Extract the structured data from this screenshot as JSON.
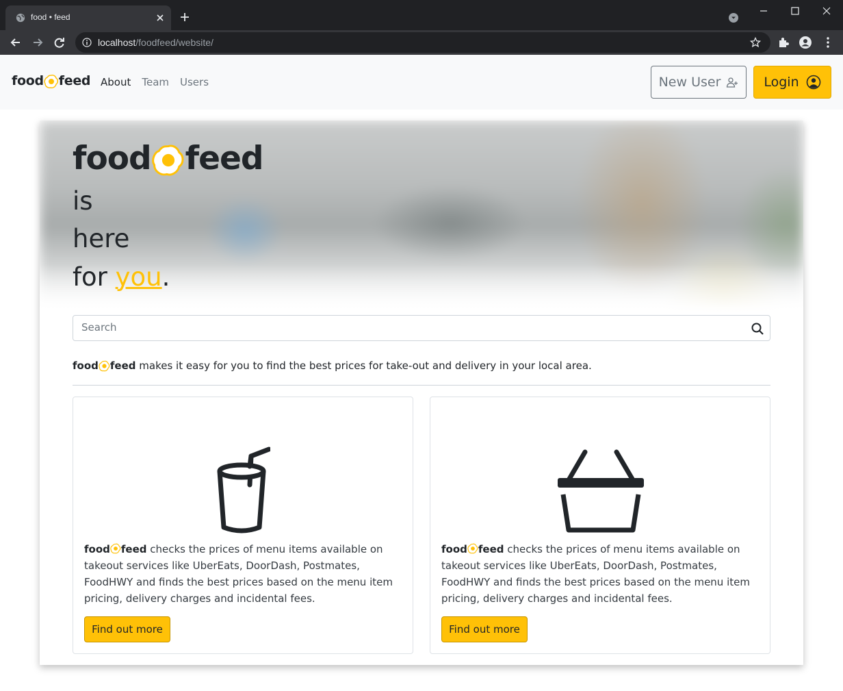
{
  "browser": {
    "tab_title": "food • feed",
    "url_host": "localhost",
    "url_path": "/foodfeed/website/"
  },
  "navbar": {
    "brand_left": "food",
    "brand_right": "feed",
    "links": [
      {
        "label": "About",
        "active": true
      },
      {
        "label": "Team",
        "active": false
      },
      {
        "label": "Users",
        "active": false
      }
    ],
    "new_user_label": "New User",
    "login_label": "Login"
  },
  "hero": {
    "brand_left": "food",
    "brand_right": "feed",
    "line1": "is",
    "line2": "here",
    "line3_prefix": "for ",
    "line3_highlight": "you",
    "line3_suffix": "."
  },
  "search": {
    "placeholder": "Search"
  },
  "tagline": {
    "brand_left": "food",
    "brand_right": "feed",
    "text": " makes it easy for you to find the best prices for take-out and delivery in your local area."
  },
  "cards": [
    {
      "icon": "cup-straw-icon",
      "brand_left": "food",
      "brand_right": "feed",
      "text": " checks the prices of menu items available on takeout services like UberEats, DoorDash, Postmates, FoodHWY and finds the best prices based on the menu item pricing, delivery charges and incidental fees.",
      "button_label": "Find out more"
    },
    {
      "icon": "basket-icon",
      "brand_left": "food",
      "brand_right": "feed",
      "text": " checks the prices of menu items available on takeout services like UberEats, DoorDash, Postmates, FoodHWY and finds the best prices based on the menu item pricing, delivery charges and incidental fees.",
      "button_label": "Find out more"
    }
  ],
  "colors": {
    "accent": "#ffc107",
    "text": "#212529",
    "chrome_bg": "#202124",
    "toolbar_bg": "#35363a"
  }
}
